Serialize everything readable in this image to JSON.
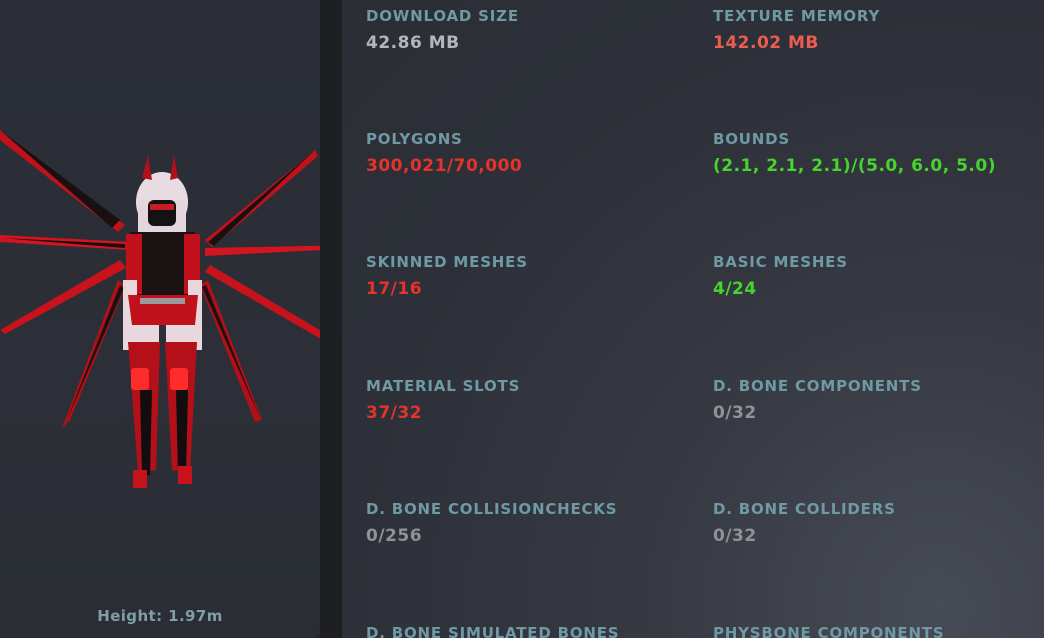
{
  "preview": {
    "height_label": "Height: 1.97m"
  },
  "colors": {
    "label": "#6f9aa3",
    "neutral": "#b3b7bb",
    "muted": "#8f9396",
    "bad": "#e4332a",
    "warn": "#ea5d50",
    "good": "#46d42d"
  },
  "stats": [
    {
      "label": "DOWNLOAD SIZE",
      "value": "42.86 MB"
    },
    {
      "label": "TEXTURE MEMORY",
      "value": "142.02 MB"
    },
    {
      "label": "POLYGONS",
      "value": "300,021/70,000"
    },
    {
      "label": "BOUNDS",
      "value": "(2.1, 2.1, 2.1)/(5.0, 6.0, 5.0)"
    },
    {
      "label": "SKINNED MESHES",
      "value": "17/16"
    },
    {
      "label": "BASIC MESHES",
      "value": "4/24"
    },
    {
      "label": "MATERIAL SLOTS",
      "value": "37/32"
    },
    {
      "label": "D. BONE COMPONENTS",
      "value": "0/32"
    },
    {
      "label": "D. BONE COLLISIONCHECKS",
      "value": "0/256"
    },
    {
      "label": "D. BONE COLLIDERS",
      "value": "0/32"
    },
    {
      "label": "D. BONE SIMULATED BONES",
      "value": ""
    },
    {
      "label": "PHYSBONE COMPONENTS",
      "value": ""
    }
  ]
}
